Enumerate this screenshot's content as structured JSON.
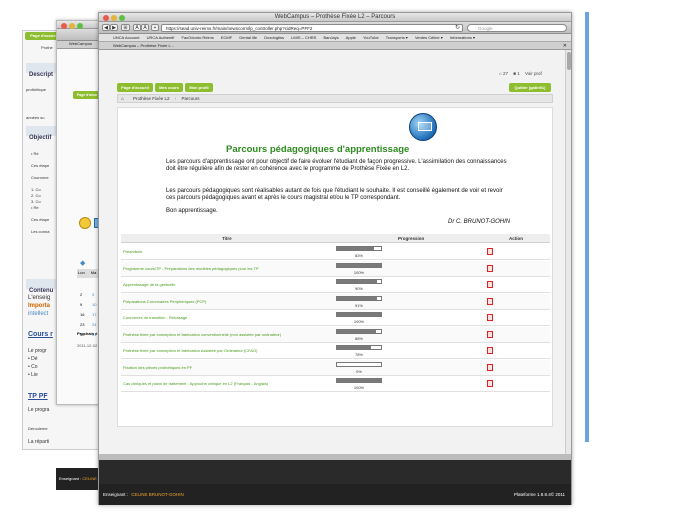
{
  "browser": {
    "window_title": "WebCampus – Prothèse Fixée L2 – Parcours",
    "url": "https://sead.univ-reims.fr/main/newscorm/lp_controller.php?cidReq=PFF2",
    "search_placeholder": "Google",
    "tab_label": "WebCampus – Prothèse Fixée L...",
    "back_tab_label": "WebCampus",
    "bookmarks": [
      "UNCA Account",
      "URCA Authentif",
      "FacOdonto Reims",
      "ECMF",
      "Dental life",
      "Doxdogtiss",
      "LMIS – CHRS",
      "BanJays",
      "Apple",
      "YouTube",
      "Transports ▾",
      "Ventes Céline ▾",
      "Informations ▾"
    ]
  },
  "header": {
    "notifications_count": "27",
    "messages_count": "1",
    "profile_link": "Voir prof",
    "nav_home": "Page d'accueil",
    "nav_courses": "Mes cours",
    "nav_profile": "Mon profil",
    "quit_button": "Quitter (gatin91)"
  },
  "breadcrumb": {
    "course": "Prothèse Fixée L2",
    "section": "Parcours"
  },
  "content": {
    "title": "Parcours pédagogiques d'apprentissage",
    "paragraph1": "Les parcours d'apprentissage ont pour objectif de faire évoluer l'étudiant de façon progressive. L'assimilation des connaissances doit être régulière afin de rester en cohérence avec le programme de Prothèse Fixée en L2.",
    "paragraph2": "Les parcours pédagogiques sont réalisables autant de fois que l'étudiant le souhaite. Il est conseillé également de voir et revoir ces parcours pédagogiques avant et après le cours magistral et/ou le TP correspondant.",
    "greeting": "Bon apprentissage.",
    "signature": "Dr C. BRUNOT-GOHIN"
  },
  "table": {
    "columns": [
      "Titre",
      "Progression",
      "Action"
    ],
    "rows": [
      {
        "title": "Préambule",
        "progress": "83%",
        "fill": 0.83
      },
      {
        "title": "Programme cours/TP - Préparations des modèles pédagogiques pour les TP",
        "progress": "100%",
        "fill": 1.0
      },
      {
        "title": "Apprentissage de la gestuelle",
        "progress": "90%",
        "fill": 0.9
      },
      {
        "title": "Préparations Coronnaires Périphériques (PCP)",
        "progress": "91%",
        "fill": 0.91
      },
      {
        "title": "Couronnes de transition - Rebasage",
        "progress": "100%",
        "fill": 1.0
      },
      {
        "title": "Prothèse fixée par conception et fabrication conventionnelle (non assistée par ordinateur)",
        "progress": "88%",
        "fill": 0.88
      },
      {
        "title": "Prothèse fixée par conception et fabrication Assistée par Ordinateur (CFAO)",
        "progress": "78%",
        "fill": 0.78
      },
      {
        "title": "Fixation des pièces prothétiques en PF",
        "progress": "0%",
        "fill": 0.0
      },
      {
        "title": "Cas cliniques et plans de traitement - Approche clinique en L2 (Français - Anglais)",
        "progress": "100%",
        "fill": 1.0
      }
    ]
  },
  "footer": {
    "teacher_label": "Enseignant :",
    "teacher_name": "CELINE BRUNOT-GOHIN",
    "platform": "Plateforme 1.8.8.4© 2011"
  },
  "background_window": {
    "nav_home": "Page d'accue",
    "tab": "Prothè",
    "section_description": "Descript",
    "section_objectives": "Objectif",
    "section_content": "Contenu",
    "course_link": "Cours r",
    "tp_link": "TP PF",
    "important": "Importa",
    "intellect": "intellect",
    "programme": "Le progra",
    "deroulement": "Dérouleme",
    "repartition": "La réparti",
    "calendar_days": [
      "Lun",
      "Ma"
    ],
    "calendar_numbers": [
      "2",
      "3",
      "9",
      "10",
      "16",
      "17",
      "23",
      "24",
      "30",
      "31"
    ],
    "next_label": "Prochain é",
    "date": "2011-12-02"
  }
}
